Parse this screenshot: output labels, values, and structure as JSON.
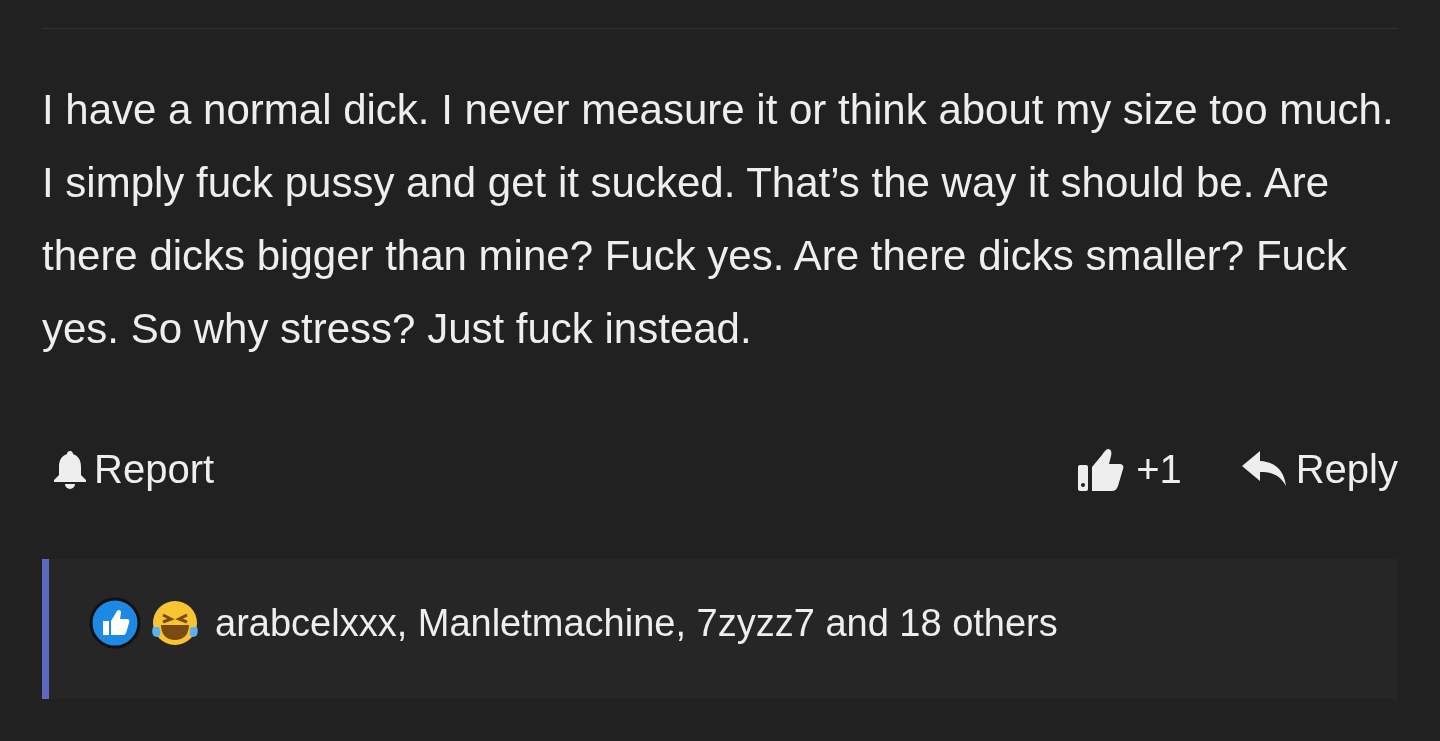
{
  "comment": {
    "body": "I have a normal dick. I never measure it or think about my size too much. I simply fuck pussy and get it sucked. That’s the way it should be. Are there dicks bigger than mine? Fuck yes. Are there dicks smaller? Fuck yes. So why stress? Just fuck instead.",
    "report": "Report",
    "score": "+1",
    "reply": "Reply"
  },
  "reactions": {
    "text": "arabcelxxx, Manletmachine, 7zyzz7 and 18 others"
  }
}
